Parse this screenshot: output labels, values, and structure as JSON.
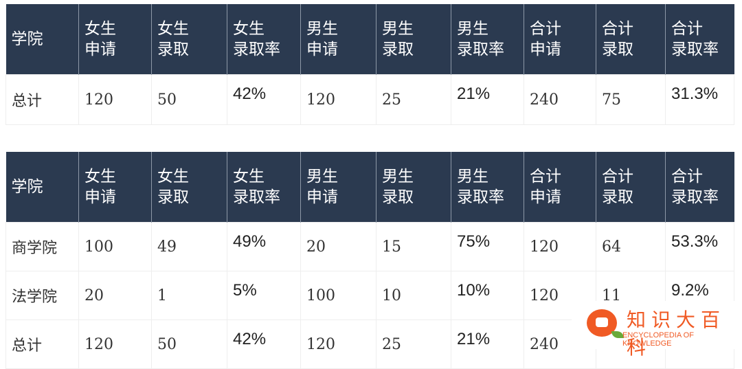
{
  "headers": [
    "学院",
    "女生\n申请",
    "女生\n录取",
    "女生\n录取率",
    "男生\n申请",
    "男生\n录取",
    "男生\n录取率",
    "合计\n申请",
    "合计\n录取",
    "合计\n录取率"
  ],
  "table1": {
    "rows": [
      [
        "总计",
        "120",
        "50",
        "42%",
        "120",
        "25",
        "21%",
        "240",
        "75",
        "31.3%"
      ]
    ]
  },
  "table2": {
    "rows": [
      [
        "商学院",
        "100",
        "49",
        "49%",
        "20",
        "15",
        "75%",
        "120",
        "64",
        "53.3%"
      ],
      [
        "法学院",
        "20",
        "1",
        "5%",
        "100",
        "10",
        "10%",
        "120",
        "11",
        "9.2%"
      ],
      [
        "总计",
        "120",
        "50",
        "42%",
        "120",
        "25",
        "21%",
        "240",
        "",
        ""
      ]
    ]
  },
  "watermark": {
    "cn": "知识大百科",
    "en": "ENCYCLOPEDIA OF KNOWLEDGE",
    "color": "#f05a24"
  },
  "colors": {
    "header_bg": "#2b3a50"
  }
}
